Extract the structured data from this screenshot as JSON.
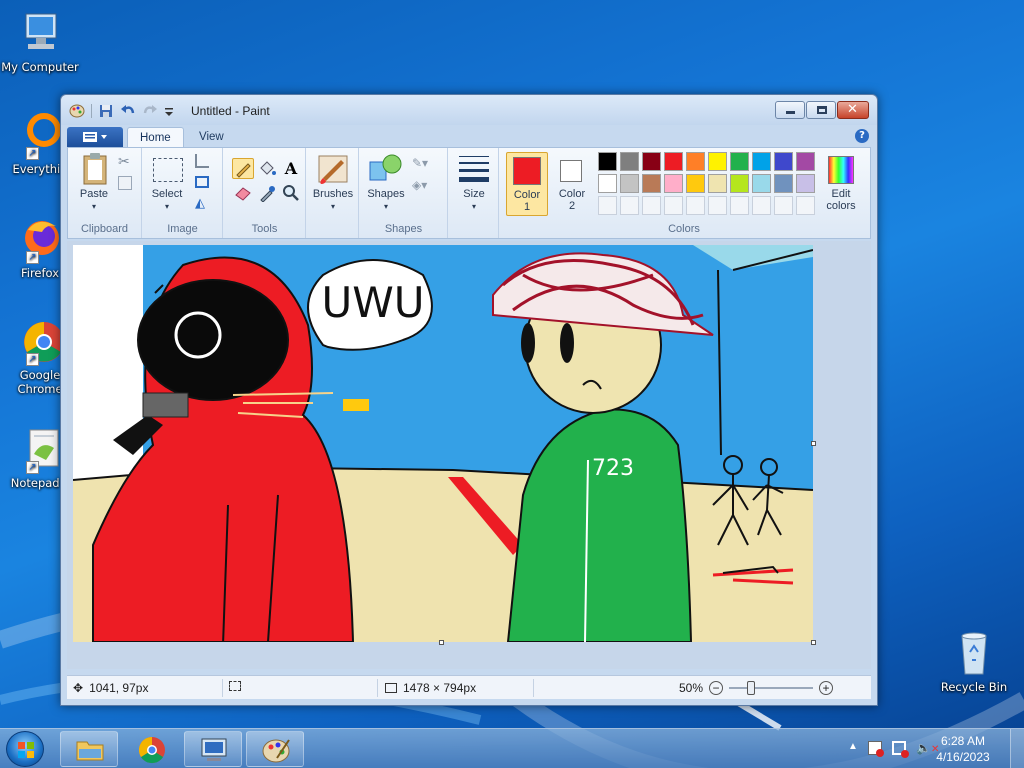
{
  "desktop": {
    "icons": [
      {
        "label": "My Computer"
      },
      {
        "label": "Everythin"
      },
      {
        "label": "Firefox"
      },
      {
        "label": "Google Chrome"
      },
      {
        "label": "Notepad+"
      },
      {
        "label": "Recycle Bin"
      }
    ]
  },
  "window": {
    "title": "Untitled - Paint",
    "tabs": [
      {
        "label": "Home"
      },
      {
        "label": "View"
      }
    ],
    "help": "?"
  },
  "ribbon": {
    "clipboard": {
      "paste": "Paste",
      "group": "Clipboard"
    },
    "image": {
      "select": "Select",
      "group": "Image"
    },
    "tools": {
      "group": "Tools",
      "text_tool": "A"
    },
    "brushes": {
      "label": "Brushes"
    },
    "shapes": {
      "label": "Shapes",
      "group": "Shapes"
    },
    "size": {
      "label": "Size"
    },
    "colors": {
      "color1": "Color 1",
      "color1_a": "Color",
      "color1_b": "1",
      "color2_a": "Color",
      "color2_b": "2",
      "edit_a": "Edit",
      "edit_b": "colors",
      "group": "Colors",
      "color1_value": "#ed1c24",
      "color2_value": "#ffffff",
      "row1": [
        "#000000",
        "#7f7f7f",
        "#880015",
        "#ed1c24",
        "#ff7f27",
        "#fff200",
        "#22b14c",
        "#00a2e8",
        "#3f48cc",
        "#a349a4"
      ],
      "row2": [
        "#ffffff",
        "#c3c3c3",
        "#b97a57",
        "#ffaec9",
        "#ffc90e",
        "#efe4b0",
        "#b5e61d",
        "#99d9ea",
        "#7092be",
        "#c8bfe7"
      ]
    }
  },
  "canvas": {
    "speech": "UWU",
    "shirt_number": "723"
  },
  "status": {
    "cursor": "1041, 97px",
    "image_size": "1478 × 794px",
    "zoom": "50%"
  },
  "taskbar": {
    "time": "6:28 AM",
    "date": "4/16/2023"
  }
}
